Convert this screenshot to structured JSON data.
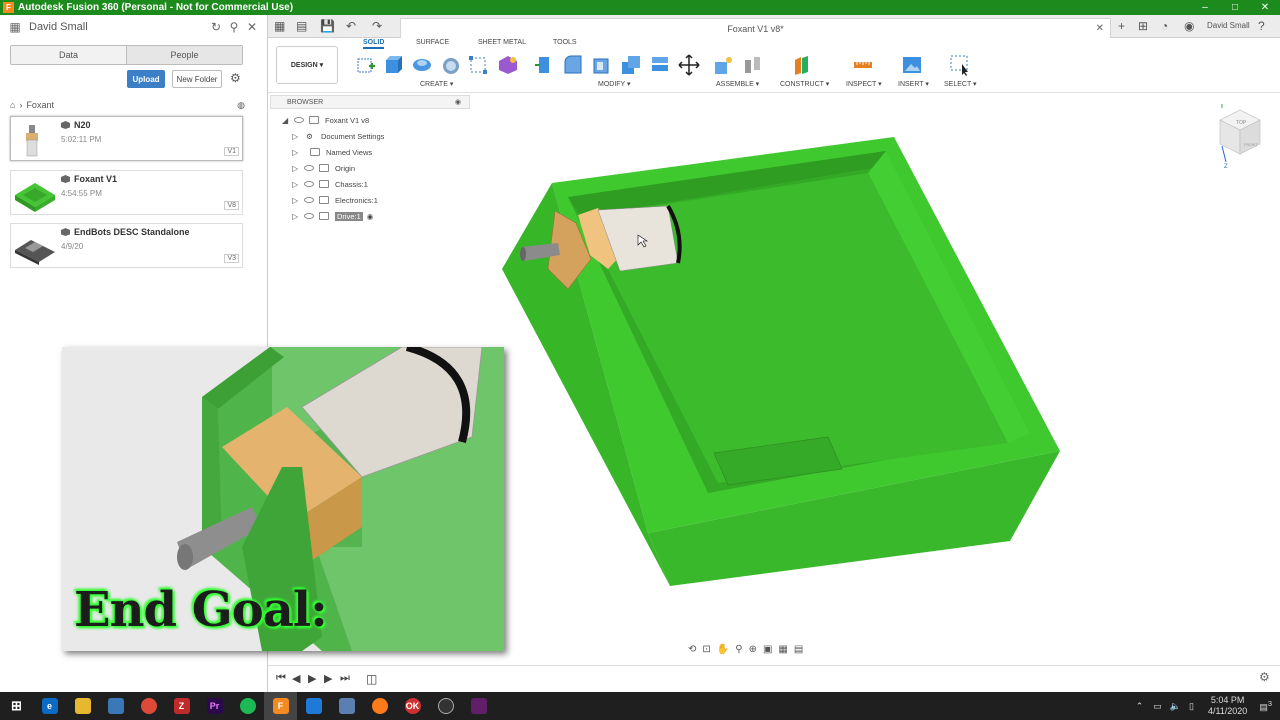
{
  "window": {
    "title": "Autodesk Fusion 360 (Personal - Not for Commercial Use)",
    "logo": "F",
    "minimize": "–",
    "maximize": "□",
    "close": "✕"
  },
  "left_panel": {
    "user": "David Small",
    "tabs": [
      "Data",
      "People"
    ],
    "upload_label": "Upload",
    "new_folder_label": "New Folder",
    "breadcrumb": "Foxant",
    "items": [
      {
        "name": "N20",
        "date": "5:02:11 PM",
        "version": "V1"
      },
      {
        "name": "Foxant V1",
        "date": "4:54:55 PM",
        "version": "V8"
      },
      {
        "name": "EndBots DESC Standalone",
        "date": "4/9/20",
        "version": "V3"
      }
    ]
  },
  "doc_tab": {
    "title": "Foxant V1 v8*",
    "close": "✕"
  },
  "header_user": "David Small",
  "toolbar": {
    "workspace": "DESIGN ▾",
    "tabs": [
      "SOLID",
      "SURFACE",
      "SHEET METAL",
      "TOOLS"
    ],
    "groups": [
      "CREATE ▾",
      "MODIFY ▾",
      "ASSEMBLE ▾",
      "CONSTRUCT ▾",
      "INSPECT ▾",
      "INSERT ▾",
      "SELECT ▾"
    ]
  },
  "browser": {
    "title": "BROWSER",
    "root": "Foxant V1 v8",
    "nodes": [
      "Document Settings",
      "Named Views",
      "Origin",
      "Chassis:1",
      "Electronics:1",
      "Drive:1"
    ]
  },
  "view_cube": {
    "top": "TOP",
    "front": "FRONT",
    "axis_z": "Z"
  },
  "overlay_text": "End Goal:",
  "taskbar": {
    "time": "5:04 PM",
    "date": "4/11/2020",
    "notifications": "3"
  },
  "colors": {
    "accent": "#1a6fb8",
    "model_green": "#3fbf2f",
    "titlebar": "#1d8a1d"
  }
}
